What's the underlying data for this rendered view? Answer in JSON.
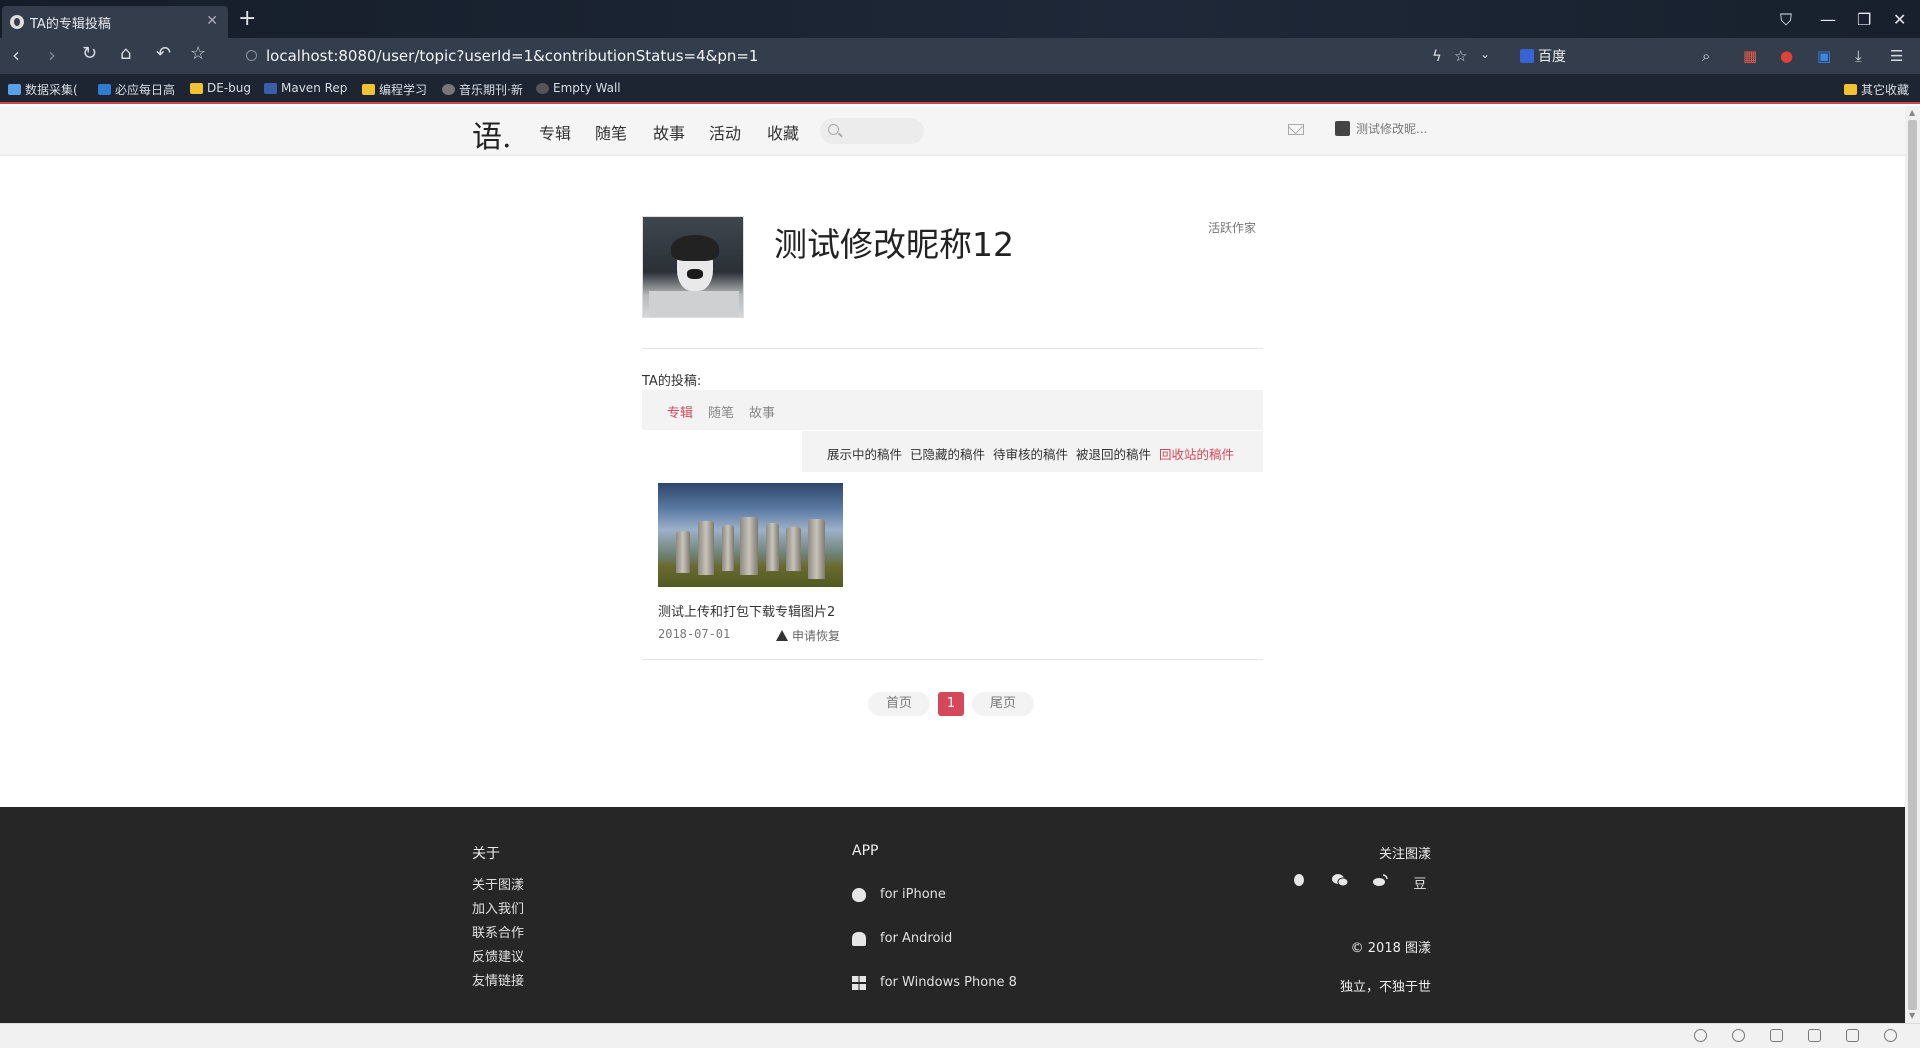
{
  "browser": {
    "tab_title": "TA的专辑投稿",
    "url": "localhost:8080/user/topic?userId=1&contributionStatus=4&pn=1",
    "search_engine": "百度",
    "bookmarks": [
      "数据采集(",
      "必应每日高",
      "DE-bug",
      "Maven Rep",
      "编程学习",
      "音乐期刊·新",
      "Empty Wall",
      "其它收藏"
    ]
  },
  "site": {
    "logo": "语.",
    "nav": [
      "专辑",
      "随笔",
      "故事",
      "活动",
      "收藏"
    ],
    "search_placeholder": "",
    "user_name": "测试修改昵..."
  },
  "profile": {
    "nickname": "测试修改昵称12",
    "badge": "活跃作家"
  },
  "contributions": {
    "title": "TA的投稿:",
    "types": [
      "专辑",
      "随笔",
      "故事"
    ],
    "active_type": "专辑",
    "statuses": [
      "展示中的稿件",
      "已隐藏的稿件",
      "待审核的稿件",
      "被退回的稿件",
      "回收站的稿件"
    ],
    "active_status": "回收站的稿件",
    "items": [
      {
        "title": "测试上传和打包下载专辑图片2",
        "date": "2018-07-01",
        "action": "申请恢复"
      }
    ]
  },
  "pagination": {
    "first": "首页",
    "current": "1",
    "last": "尾页"
  },
  "footer": {
    "about_title": "关于",
    "about_links": [
      "关于图漾",
      "加入我们",
      "联系合作",
      "反馈建议",
      "友情链接"
    ],
    "app_title": "APP",
    "apps": [
      "for iPhone",
      "for Android",
      "for Windows Phone 8"
    ],
    "follow_title": "关注图漾",
    "social_icons": [
      "qq-icon",
      "wechat-icon",
      "weibo-icon",
      "douban-icon"
    ],
    "douban_glyph": "豆",
    "copyright": "© 2018 图漾",
    "slogan": "独立，不独于世"
  },
  "colors": {
    "accent": "#d5485a",
    "footer_bg": "#262626",
    "header_bg": "#f5f5f5"
  }
}
